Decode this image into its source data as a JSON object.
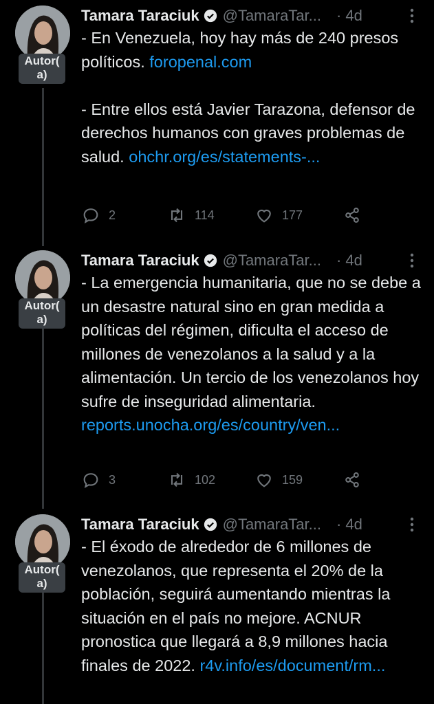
{
  "badge_label": "Autor(\na)",
  "tweets": [
    {
      "name": "Tamara Taraciuk",
      "handle": "@TamaraTar...",
      "time": "4d",
      "p1": "- En Venezuela, hoy hay más de 240 presos políticos.",
      "p1_link": "foropenal.com",
      "p2": "- Entre ellos está Javier Tarazona, defensor de derechos humanos con graves problemas de salud.",
      "p2_link": "ohchr.org/es/statements-...",
      "replies": "2",
      "retweets": "114",
      "likes": "177"
    },
    {
      "name": "Tamara Taraciuk",
      "handle": "@TamaraTar...",
      "time": "4d",
      "p1": "- La emergencia humanitaria, que no se debe a un desastre natural sino en gran medida a políticas del régimen, dificulta el acceso de millones de venezolanos a la salud y a la alimentación. Un tercio de los venezolanos hoy sufre de inseguridad alimentaria.",
      "p1_link": "reports.unocha.org/es/country/ven...",
      "replies": "3",
      "retweets": "102",
      "likes": "159"
    },
    {
      "name": "Tamara Taraciuk",
      "handle": "@TamaraTar...",
      "time": "4d",
      "p1": "- El éxodo de alrededor de 6 millones de venezolanos, que representa el 20% de la población, seguirá aumentando mientras la situación en el país no mejore. ACNUR pronostica que llegará a 8,9 millones hacia finales de 2022.",
      "p1_link": "r4v.info/es/document/rm..."
    }
  ],
  "colors": {
    "background": "#000000",
    "text": "#e7e9ea",
    "muted": "#71767b",
    "link": "#1d9bf0"
  },
  "icons": [
    "verified-icon",
    "more-icon",
    "reply-icon",
    "retweet-icon",
    "like-icon",
    "share-icon"
  ]
}
